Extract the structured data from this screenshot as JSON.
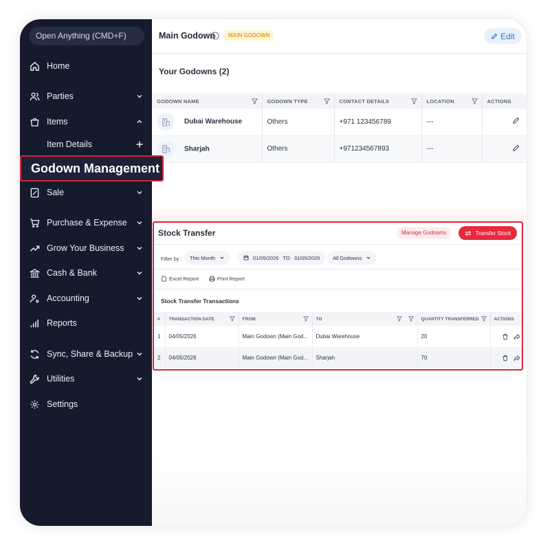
{
  "sidebar": {
    "search_placeholder": "Open Anything (CMD+F)",
    "items": [
      {
        "label": "Home",
        "icon": "home-icon"
      },
      {
        "label": "Parties",
        "icon": "users-icon"
      },
      {
        "label": "Items",
        "icon": "shopping-bag-icon"
      },
      {
        "label": "Item Details",
        "icon": "plus-icon"
      },
      {
        "label": "Godown Management"
      },
      {
        "label": "Sale",
        "icon": "receipt-icon"
      },
      {
        "label": "Purchase & Expense",
        "icon": "cart-icon"
      },
      {
        "label": "Grow Your Business",
        "icon": "trending-up-icon"
      },
      {
        "label": "Cash & Bank",
        "icon": "bank-icon"
      },
      {
        "label": "Accounting",
        "icon": "user-settings-icon"
      },
      {
        "label": "Reports",
        "icon": "bar-chart-icon"
      },
      {
        "label": "Sync, Share & Backup",
        "icon": "sync-icon"
      },
      {
        "label": "Utilities",
        "icon": "wrench-icon"
      },
      {
        "label": "Settings",
        "icon": "gear-icon"
      }
    ]
  },
  "header": {
    "title": "Main Godown",
    "badge": "MAIN GODOWN",
    "edit_label": "Edit"
  },
  "godowns": {
    "title": "Your Godowns (2)",
    "columns": [
      "GODOWN NAME",
      "GODOWN TYPE",
      "CONTACT DETAILS",
      "LOCATION",
      "ACTIONS"
    ],
    "rows": [
      {
        "name": "Dubai Warehouse",
        "type": "Others",
        "contact": "+971 123456789",
        "location": "---"
      },
      {
        "name": "Sharjah",
        "type": "Others",
        "contact": "+971234567893",
        "location": "---"
      }
    ]
  },
  "stock_transfer": {
    "title": "Stock Transfer",
    "manage_label": "Manage Godowns",
    "transfer_label": "Transfer Stock",
    "filter_by": "Filter by :",
    "period": "This Month",
    "date_from": "01/05/2026",
    "to_label": "TO",
    "date_to": "31/05/2026",
    "godown_filter": "All Godowns",
    "excel_label": "Excel Report",
    "print_label": "Print Report",
    "tx_title": "Stock Transfer Transactions",
    "columns": [
      "#",
      "TRANSACTION DATE",
      "FROM",
      "TO",
      "QUANTITY TRANSFERRED",
      "ACTIONS"
    ],
    "rows": [
      {
        "num": "1",
        "date": "04/05/2026",
        "from": "Main Godown (Main God...",
        "to": "Dubai Warehouse",
        "qty": "20"
      },
      {
        "num": "2",
        "date": "04/05/2026",
        "from": "Main Godown (Main God...",
        "to": "Sharjah",
        "qty": "70"
      }
    ]
  },
  "colors": {
    "sidebar_bg": "#151a2d",
    "accent_red": "#e8283f",
    "badge_text": "#e3a21a",
    "edit_blue": "#2f6fd2"
  }
}
